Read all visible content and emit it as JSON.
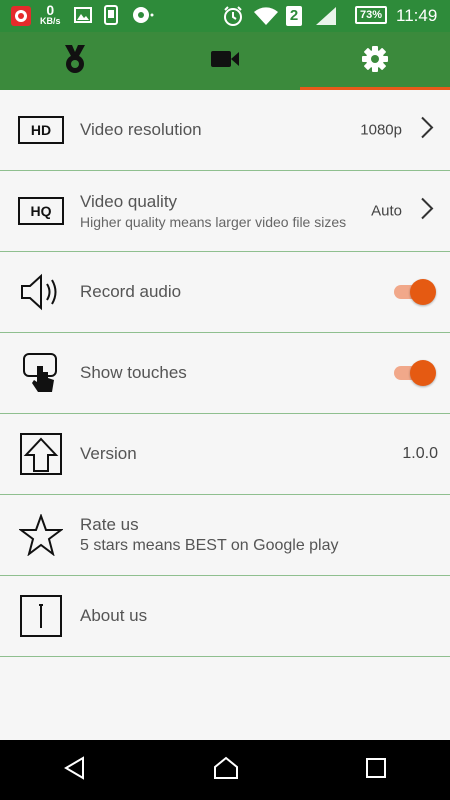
{
  "status": {
    "speed_value": "0",
    "speed_unit": "KB/s",
    "sim": "2",
    "battery": "73%",
    "time": "11:49"
  },
  "tabs": [
    {
      "name": "medal-icon",
      "active": false
    },
    {
      "name": "video-camera-icon",
      "active": false
    },
    {
      "name": "gear-icon",
      "active": true
    }
  ],
  "settings": {
    "video_resolution": {
      "badge": "HD",
      "title": "Video resolution",
      "value": "1080p"
    },
    "video_quality": {
      "badge": "HQ",
      "title": "Video quality",
      "subtitle": "Higher quality means larger video file sizes",
      "value": "Auto"
    },
    "record_audio": {
      "title": "Record audio",
      "enabled": true
    },
    "show_touches": {
      "title": "Show touches",
      "enabled": true
    },
    "version": {
      "title": "Version",
      "value": "1.0.0"
    },
    "rate_us": {
      "title": "Rate us",
      "subtitle": "5 stars means BEST on Google play"
    },
    "about_us": {
      "title": "About us"
    }
  },
  "colors": {
    "header_green": "#3b8a3c",
    "status_green": "#2e8b3a",
    "accent_orange": "#e85a1a",
    "divider": "#8fbf8f"
  }
}
